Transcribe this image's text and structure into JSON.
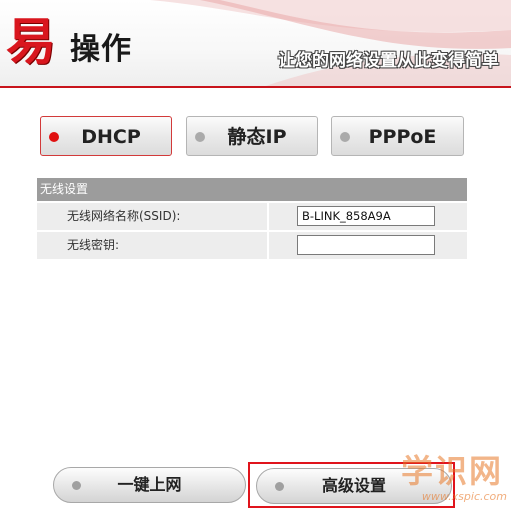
{
  "header": {
    "logo_char": "易",
    "logo_text": "操作",
    "slogan": "让您的网络设置从此变得简单"
  },
  "modes": [
    {
      "label": "DHCP",
      "active": true
    },
    {
      "label": "静态IP",
      "active": false
    },
    {
      "label": "PPPoE",
      "active": false
    }
  ],
  "wireless": {
    "section_title": "无线设置",
    "ssid_label": "无线网络名称(SSID):",
    "ssid_value": "B-LINK_858A9A",
    "key_label": "无线密钥:",
    "key_value": ""
  },
  "footer": {
    "one_click_label": "一键上网",
    "advanced_label": "高级设置"
  },
  "watermark": {
    "chars": "学识网",
    "url": "www.xspic.com"
  },
  "colors": {
    "brand_red": "#d9161e",
    "active_dot": "#e01010",
    "section_header_bg": "#9c9c9c"
  }
}
